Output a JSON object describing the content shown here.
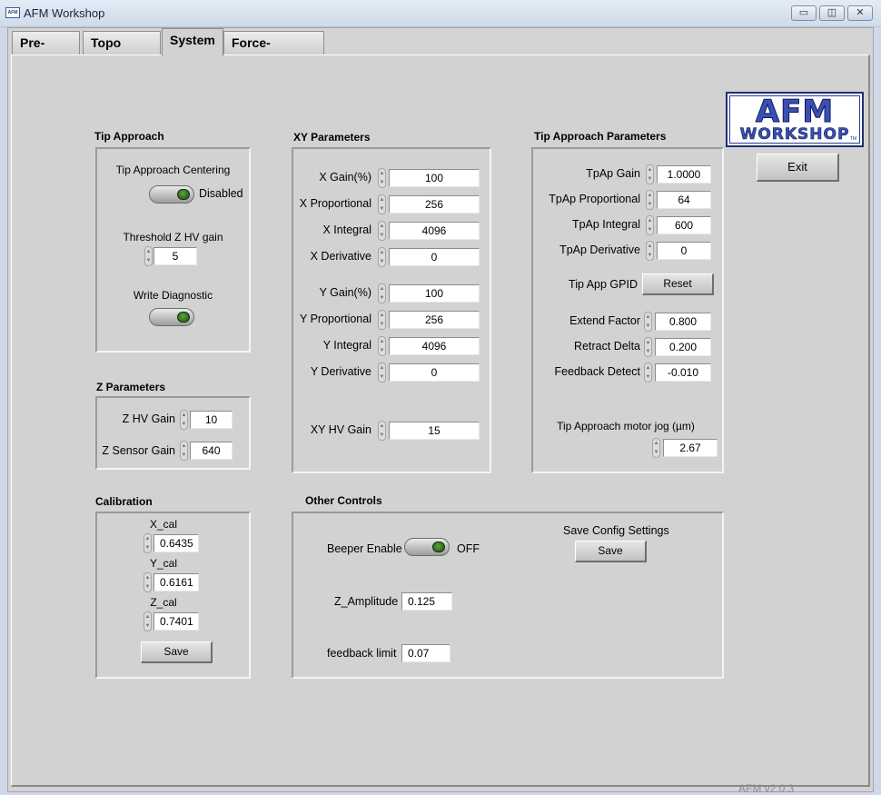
{
  "window": {
    "title": "AFM Workshop",
    "app_icon_text": "AFM",
    "minimize_glyph": "▭",
    "maximize_glyph": "◫",
    "close_glyph": "✕"
  },
  "tabs": [
    {
      "label": "Pre-Scan"
    },
    {
      "label": "Topo Scan"
    },
    {
      "label": "System"
    },
    {
      "label": "Force-Distance"
    }
  ],
  "active_tab": "System",
  "logo": {
    "line1": "AFM",
    "line2": "WORKSHOP",
    "tm": "TM"
  },
  "exit_label": "Exit",
  "tip_approach": {
    "title": "Tip Approach",
    "centering_label": "Tip Approach Centering",
    "centering_state": "Disabled",
    "threshold_label": "Threshold Z HV gain",
    "threshold_value": "5",
    "write_diag_label": "Write Diagnostic"
  },
  "z_parameters": {
    "title": "Z Parameters",
    "hv_gain_label": "Z HV Gain",
    "hv_gain_value": "10",
    "sensor_gain_label": "Z Sensor Gain",
    "sensor_gain_value": "640"
  },
  "calibration": {
    "title": "Calibration",
    "x_label": "X_cal",
    "x_value": "0.6435",
    "y_label": "Y_cal",
    "y_value": "0.6161",
    "z_label": "Z_cal",
    "z_value": "0.7401",
    "save_label": "Save"
  },
  "xy_parameters": {
    "title": "XY Parameters",
    "rows": [
      {
        "label": "X Gain(%)",
        "value": "100"
      },
      {
        "label": "X Proportional",
        "value": "256"
      },
      {
        "label": "X Integral",
        "value": "4096"
      },
      {
        "label": "X Derivative",
        "value": "0"
      },
      {
        "label": "Y Gain(%)",
        "value": "100"
      },
      {
        "label": "Y Proportional",
        "value": "256"
      },
      {
        "label": "Y Integral",
        "value": "4096"
      },
      {
        "label": "Y Derivative",
        "value": "0"
      }
    ],
    "hv_gain_label": "XY HV Gain",
    "hv_gain_value": "15"
  },
  "tip_approach_parameters": {
    "title": "Tip Approach Parameters",
    "rows": [
      {
        "label": "TpAp Gain",
        "value": "1.0000"
      },
      {
        "label": "TpAp Proportional",
        "value": "64"
      },
      {
        "label": "TpAp Integral",
        "value": "600"
      },
      {
        "label": "TpAp Derivative",
        "value": "0"
      }
    ],
    "gpid_label": "Tip App GPID",
    "reset_label": "Reset",
    "extend_label": "Extend Factor",
    "extend_value": "0.800",
    "retract_label": "Retract Delta",
    "retract_value": "0.200",
    "feedback_label": "Feedback Detect",
    "feedback_value": "-0.010",
    "motor_jog_label": "Tip Approach motor jog (µm)",
    "motor_jog_value": "2.67"
  },
  "other_controls": {
    "title": "Other Controls",
    "beeper_label": "Beeper Enable",
    "beeper_state": "OFF",
    "save_config_label": "Save Config Settings",
    "save_label": "Save",
    "z_amplitude_label": "Z_Amplitude",
    "z_amplitude_value": "0.125",
    "feedback_limit_label": "feedback limit",
    "feedback_limit_value": "0.07"
  },
  "version": "AFM v2.0.3"
}
